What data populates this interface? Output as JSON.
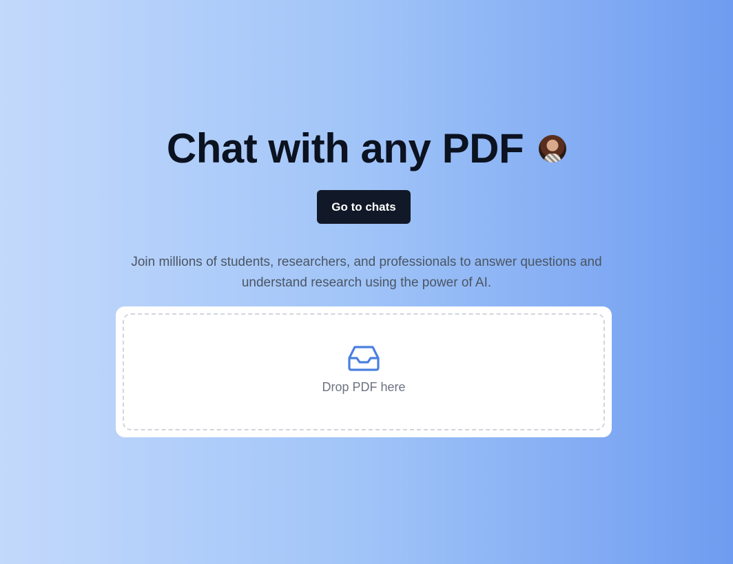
{
  "hero": {
    "title": "Chat with any PDF",
    "avatar_icon": "user-avatar",
    "cta_label": "Go to chats",
    "subtitle": "Join millions of students, researchers, and professionals to answer questions and understand research using the power of AI."
  },
  "upload": {
    "icon": "inbox-icon",
    "label": "Drop PDF here"
  },
  "colors": {
    "background_start": "#c3d9fb",
    "background_end": "#6f9cf0",
    "button_bg": "#111827",
    "title_text": "#0b1220",
    "icon_accent": "#4a7fe0"
  }
}
